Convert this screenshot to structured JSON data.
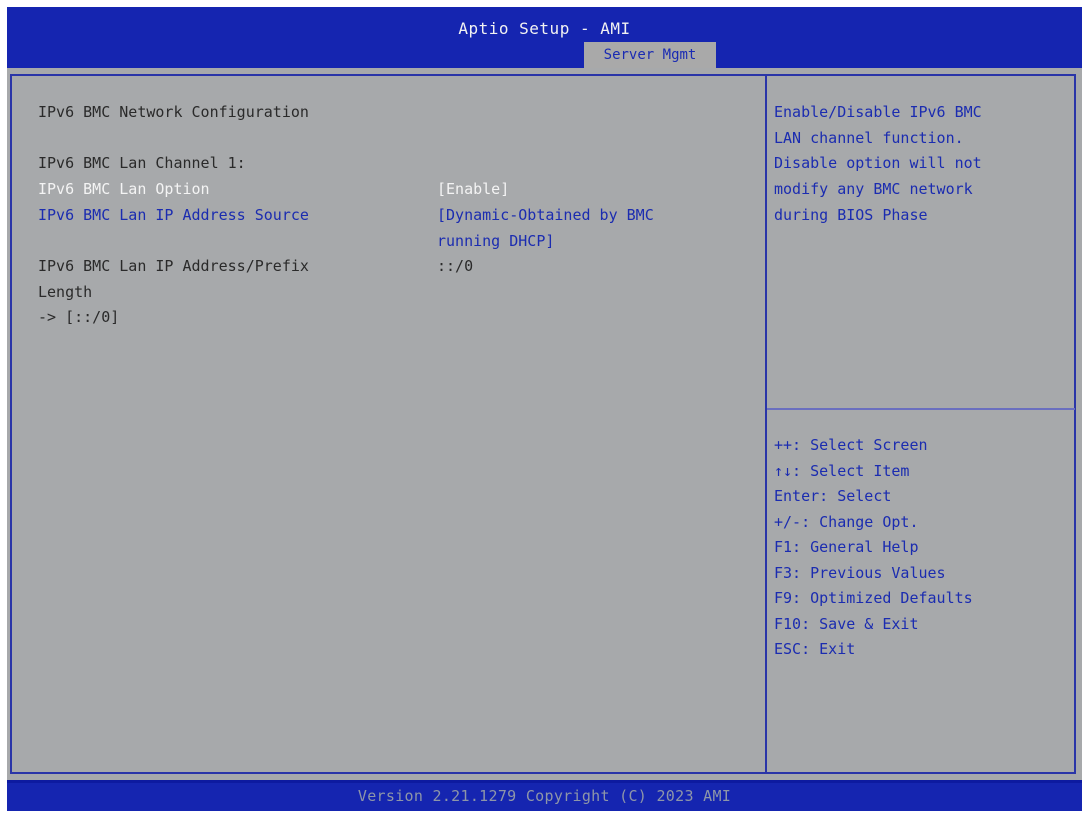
{
  "header": {
    "title": "Aptio Setup - AMI",
    "active_tab": "Server Mgmt"
  },
  "main": {
    "section_title": "IPv6 BMC Network Configuration",
    "channel_label": "IPv6 BMC Lan Channel 1:",
    "options": [
      {
        "label": "IPv6 BMC Lan Option",
        "value": "[Enable]",
        "selected": true
      },
      {
        "label": "IPv6 BMC Lan IP Address Source",
        "value_line1": "[Dynamic-Obtained by BMC",
        "value_line2": "running DHCP]",
        "selected": false
      }
    ],
    "address_label_line1": "IPv6 BMC Lan IP Address/Prefix",
    "address_label_line2": "Length",
    "address_value": "::/0",
    "address_current": "-> [::/0]"
  },
  "help": {
    "lines": [
      "Enable/Disable IPv6 BMC",
      "LAN channel function.",
      "Disable option will not",
      "modify any BMC network",
      "during BIOS Phase"
    ]
  },
  "keys": [
    "++: Select Screen",
    "↑↓: Select Item",
    "Enter: Select",
    "+/-: Change Opt.",
    "F1: General Help",
    "F3: Previous Values",
    "F9: Optimized Defaults",
    "F10: Save & Exit",
    "ESC: Exit"
  ],
  "footer": {
    "version": "Version 2.21.1279 Copyright (C) 2023 AMI"
  },
  "colors": {
    "header_bg": "#1525b0",
    "panel_bg": "#a7a9ab",
    "selected_text": "#f4f4f4",
    "option_text": "#1b2cb0",
    "static_text": "#2a2a2a"
  }
}
